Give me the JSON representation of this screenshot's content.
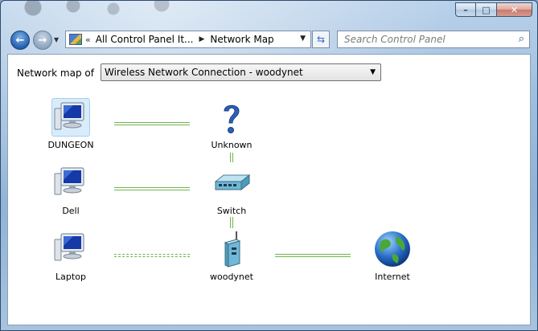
{
  "window": {
    "minimize_label": "",
    "maximize_label": "",
    "close_label": ""
  },
  "address": {
    "segments": [
      "All Control Panel It...",
      "Network Map"
    ]
  },
  "search": {
    "placeholder": "Search Control Panel"
  },
  "map": {
    "label": "Network map of",
    "connection": "Wireless Network Connection - woodynet"
  },
  "nodes": {
    "dungeon": "DUNGEON",
    "unknown": "Unknown",
    "dell": "Dell",
    "switch": "Switch",
    "laptop": "Laptop",
    "router": "woodynet",
    "internet": "Internet"
  },
  "colors": {
    "link": "#6fb64e",
    "frame": "#9fbedd",
    "selection": "#d9ecfb"
  },
  "icons": {
    "dungeon": "computer-icon",
    "unknown": "question-mark-icon",
    "dell": "computer-icon",
    "switch": "network-switch-icon",
    "laptop": "computer-icon",
    "router": "wireless-router-icon",
    "internet": "globe-icon"
  }
}
